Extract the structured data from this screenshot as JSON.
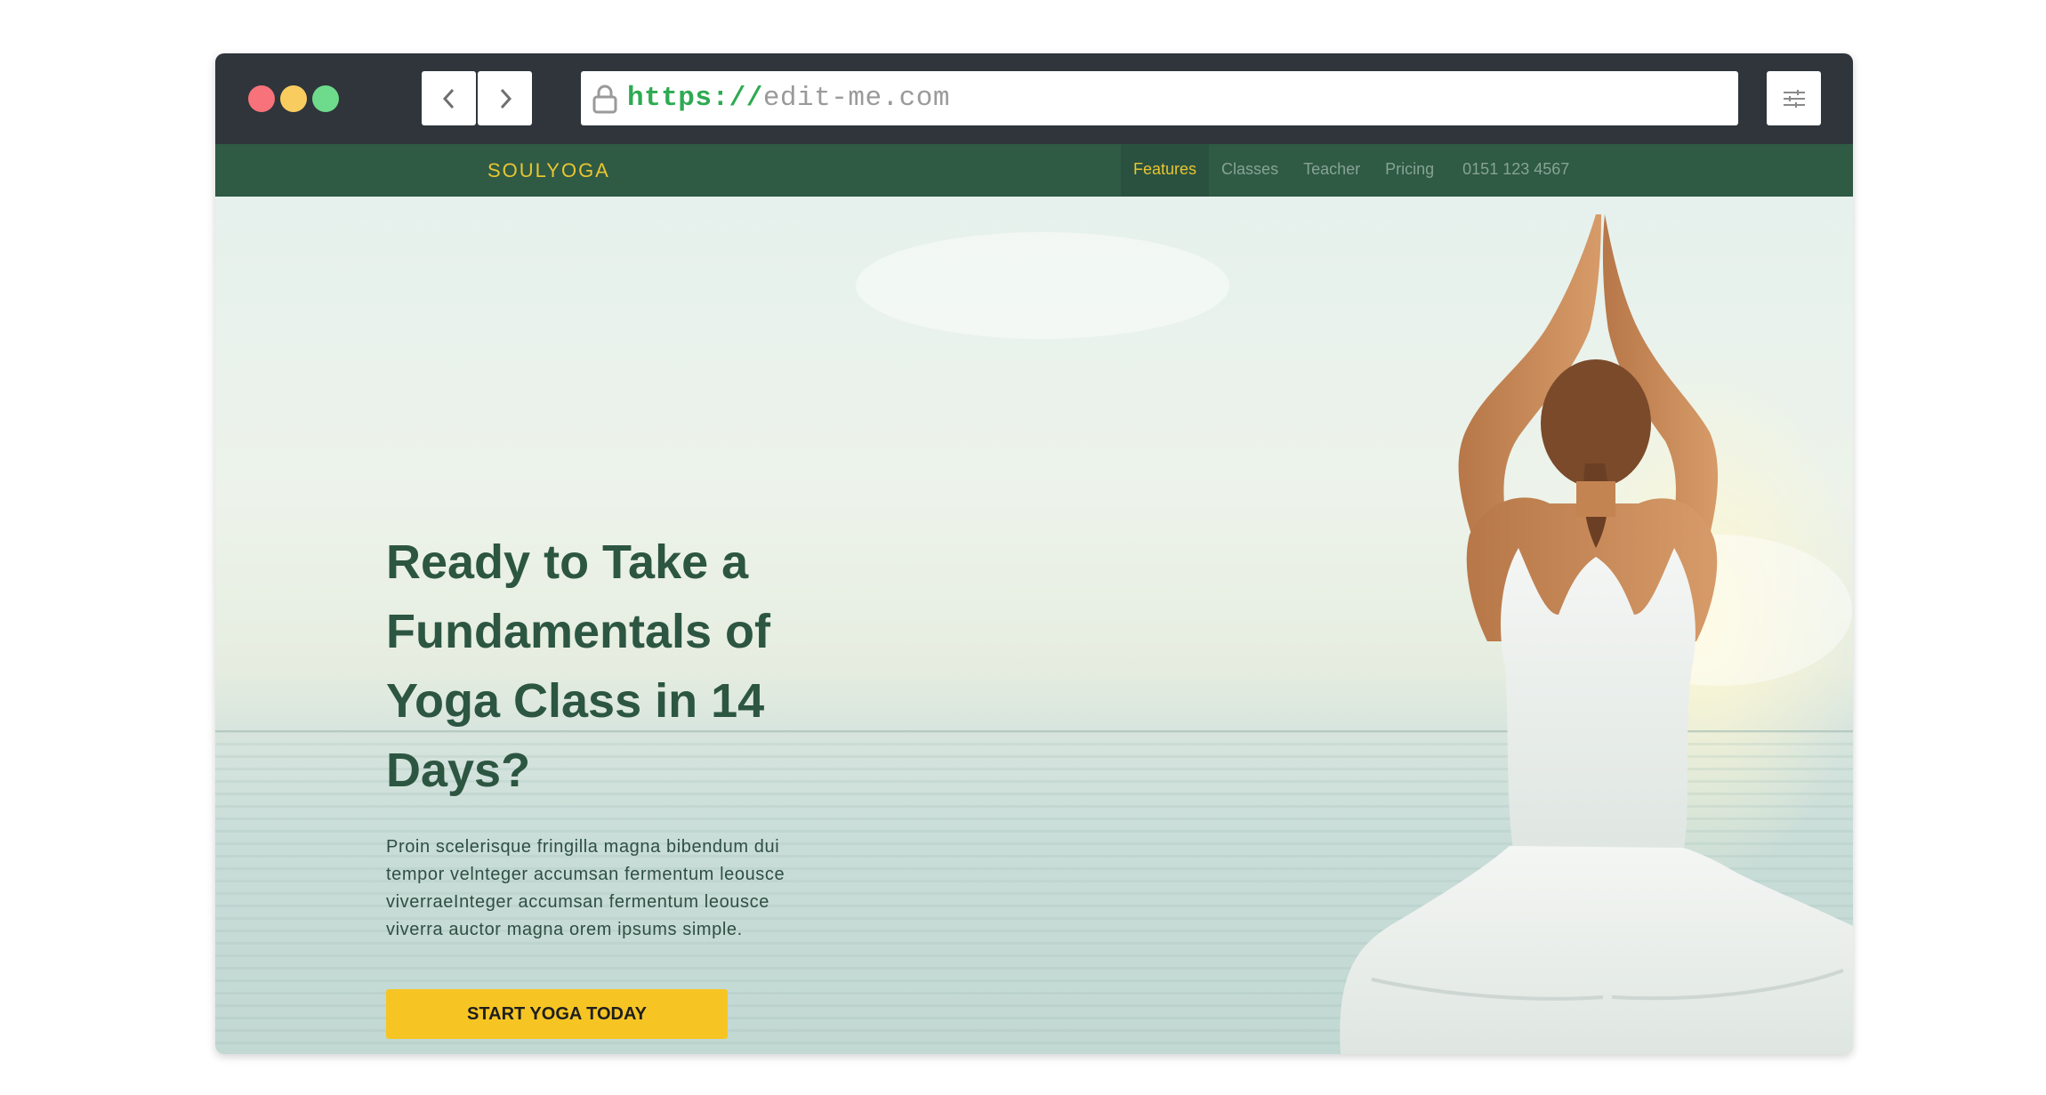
{
  "browser": {
    "url_protocol": "https://",
    "url_host": "edit-me.com"
  },
  "site": {
    "brand": "SOULYOGA",
    "nav": [
      {
        "label": "Features",
        "active": true
      },
      {
        "label": "Classes",
        "active": false
      },
      {
        "label": "Teacher",
        "active": false
      },
      {
        "label": "Pricing",
        "active": false
      },
      {
        "label": "0151 123 4567",
        "active": false
      }
    ]
  },
  "hero": {
    "headline_lines": [
      "Ready to Take a",
      "Fundamentals of",
      "Yoga Class in 14",
      "Days?"
    ],
    "paragraph_lines": [
      "Proin scelerisque fringilla magna bibendum dui",
      "tempor velnteger accumsan fermentum leousce",
      "viverraeInteger accumsan fermentum leousce",
      "viverra auctor magna orem ipsums simple."
    ],
    "cta_label": "START YOGA TODAY"
  },
  "icons": {
    "back": "chevron-left-icon",
    "forward": "chevron-right-icon",
    "lock": "lock-icon",
    "settings": "sliders-icon"
  },
  "colors": {
    "chrome": "#2f353b",
    "nav_bg": "#2f5a44",
    "brand": "#e9c531",
    "headline": "#2c5641",
    "cta": "#f6c524",
    "url_protocol": "#2eaa52"
  }
}
